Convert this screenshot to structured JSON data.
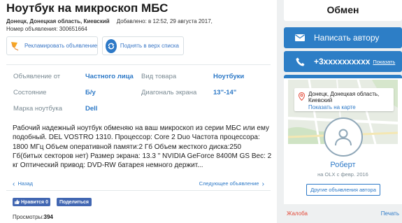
{
  "listing": {
    "title": "Ноутбук на микроскоп МБС",
    "location": "Донецк, Донецкая область, Киевский",
    "added": "Добавлено: в 12:52, 29 августа 2017,",
    "ad_number": "Номер объявления: 300651664"
  },
  "actions": {
    "promote_label": "Рекламировать объявление",
    "raise_label": "Поднять в верх списка"
  },
  "details": [
    {
      "label": "Объявление от",
      "value": "Частного лица"
    },
    {
      "label": "Вид товара",
      "value": "Ноутбуки"
    },
    {
      "label": "Состояние",
      "value": "Б/у"
    },
    {
      "label": "Диагональ экрана",
      "value": "13\"-14\""
    },
    {
      "label": "Марка ноутбука",
      "value": "Dell"
    }
  ],
  "description": "Рабочий надежный ноутбук обменяю на ваш микроскоп из серии МБС или ему подобный. DEL VOSTRO 1310. Процессор: Core 2 Duo Частота процессора: 1800 МГц Объем оперативной памяти:2 Гб Объем жесткого диска:250 Гб(битых секторов нет) Размер экрана: 13.3 \" NVIDIA GeForce 8400M GS Вес: 2 кг Оптический привод: DVD-RW батарея немного держит...",
  "navigation": {
    "prev_label": "Назад",
    "next_label": "Следующее объявление"
  },
  "social": {
    "like_label": "Нравится 0",
    "share_label": "Поделиться"
  },
  "views": {
    "label": "Просмотры:",
    "count": "394"
  },
  "sidebar": {
    "exchange_label": "Обмен",
    "write_author_label": "Написать автору",
    "phone_masked": "+3xxxxxxxxxx",
    "show_phone_label": "Показать",
    "location": "Донецк, Донецкая область, Киевский",
    "show_on_map_label": "Показать на карте",
    "author_name": "Роберт",
    "member_since": "на OLX с февр. 2016",
    "other_ads_label": "Другие объявления автора",
    "complain_label": "Жалоба",
    "print_label": "Печать"
  },
  "colors": {
    "accent": "#2d79c7",
    "button_blue": "#2d7ec6",
    "facebook": "#4267b2",
    "complain_red": "#e34b3a",
    "label_gray": "#7a8a93"
  },
  "icons": {
    "promote": "kite-icon",
    "raise": "refresh-icon",
    "write": "envelope-icon",
    "phone": "phone-icon",
    "location": "map-pin-icon",
    "avatar": "user-avatar-icon"
  }
}
